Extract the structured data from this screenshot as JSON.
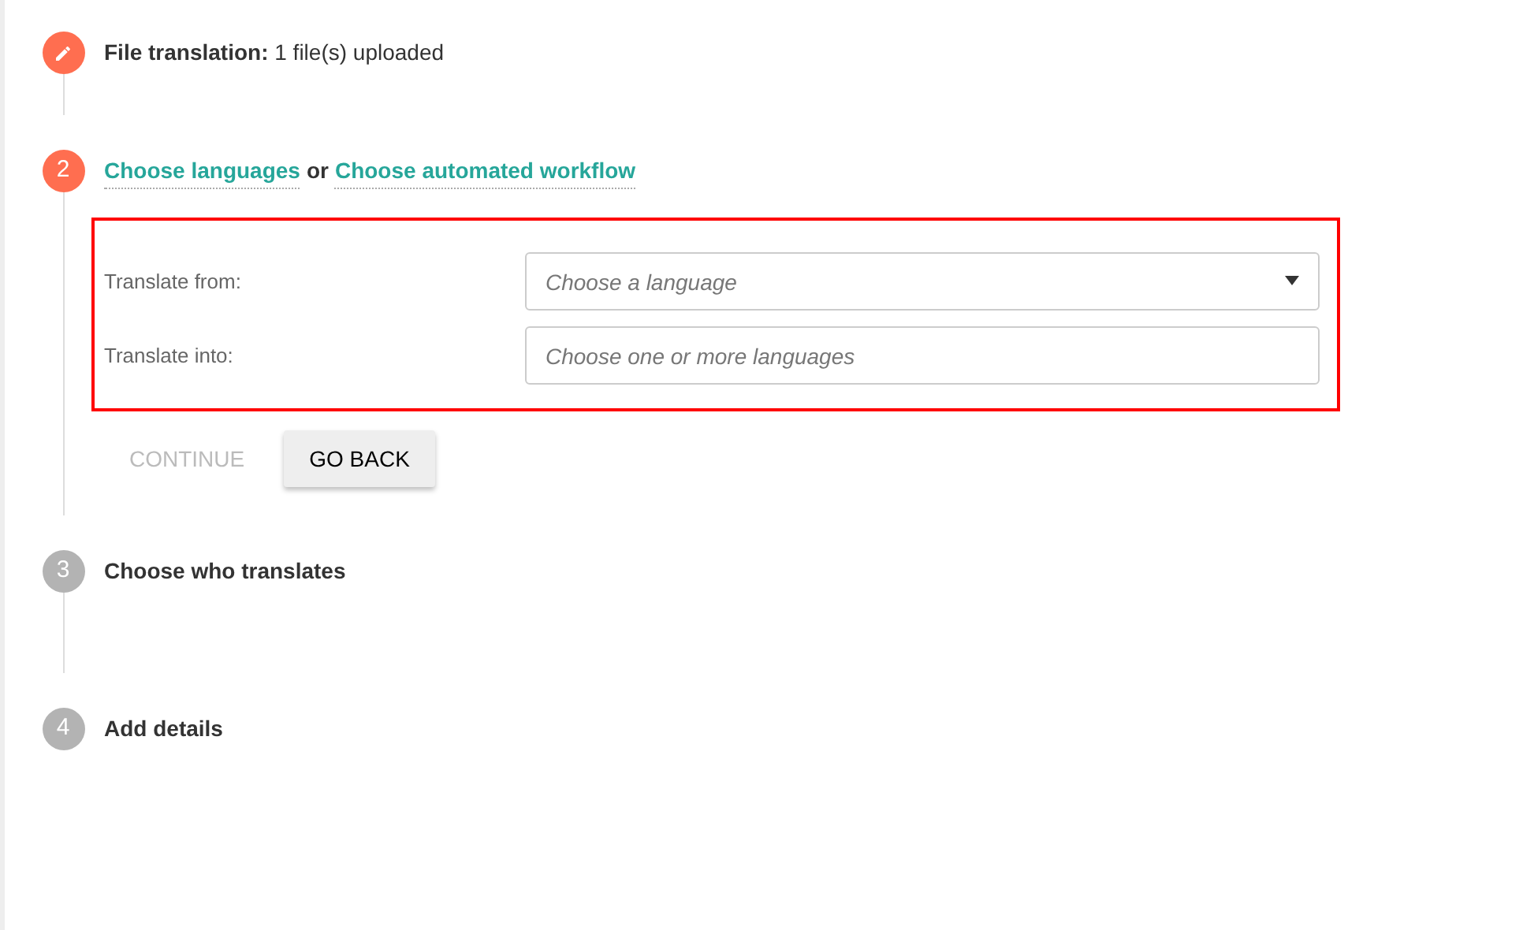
{
  "steps": [
    {
      "kind": "edit",
      "completed": true,
      "active": false,
      "title": "File translation:",
      "detail": "1 file(s) uploaded"
    },
    {
      "kind": "links",
      "completed": false,
      "active": true,
      "number": "2",
      "links": [
        "Choose languages",
        "Choose automated workflow"
      ],
      "joiner": "or",
      "form": {
        "highlighted": true,
        "fields": [
          {
            "label": "Translate from:",
            "placeholder": "Choose a language",
            "kind": "select"
          },
          {
            "label": "Translate into:",
            "placeholder": "Choose one or more languages",
            "kind": "text"
          }
        ]
      },
      "buttons": [
        {
          "label": "CONTINUE",
          "disabled": true
        },
        {
          "label": "GO BACK",
          "disabled": false
        }
      ]
    },
    {
      "kind": "plain",
      "completed": false,
      "active": false,
      "number": "3",
      "title": "Choose who translates"
    },
    {
      "kind": "plain",
      "completed": false,
      "active": false,
      "number": "4",
      "title": "Add details"
    }
  ]
}
